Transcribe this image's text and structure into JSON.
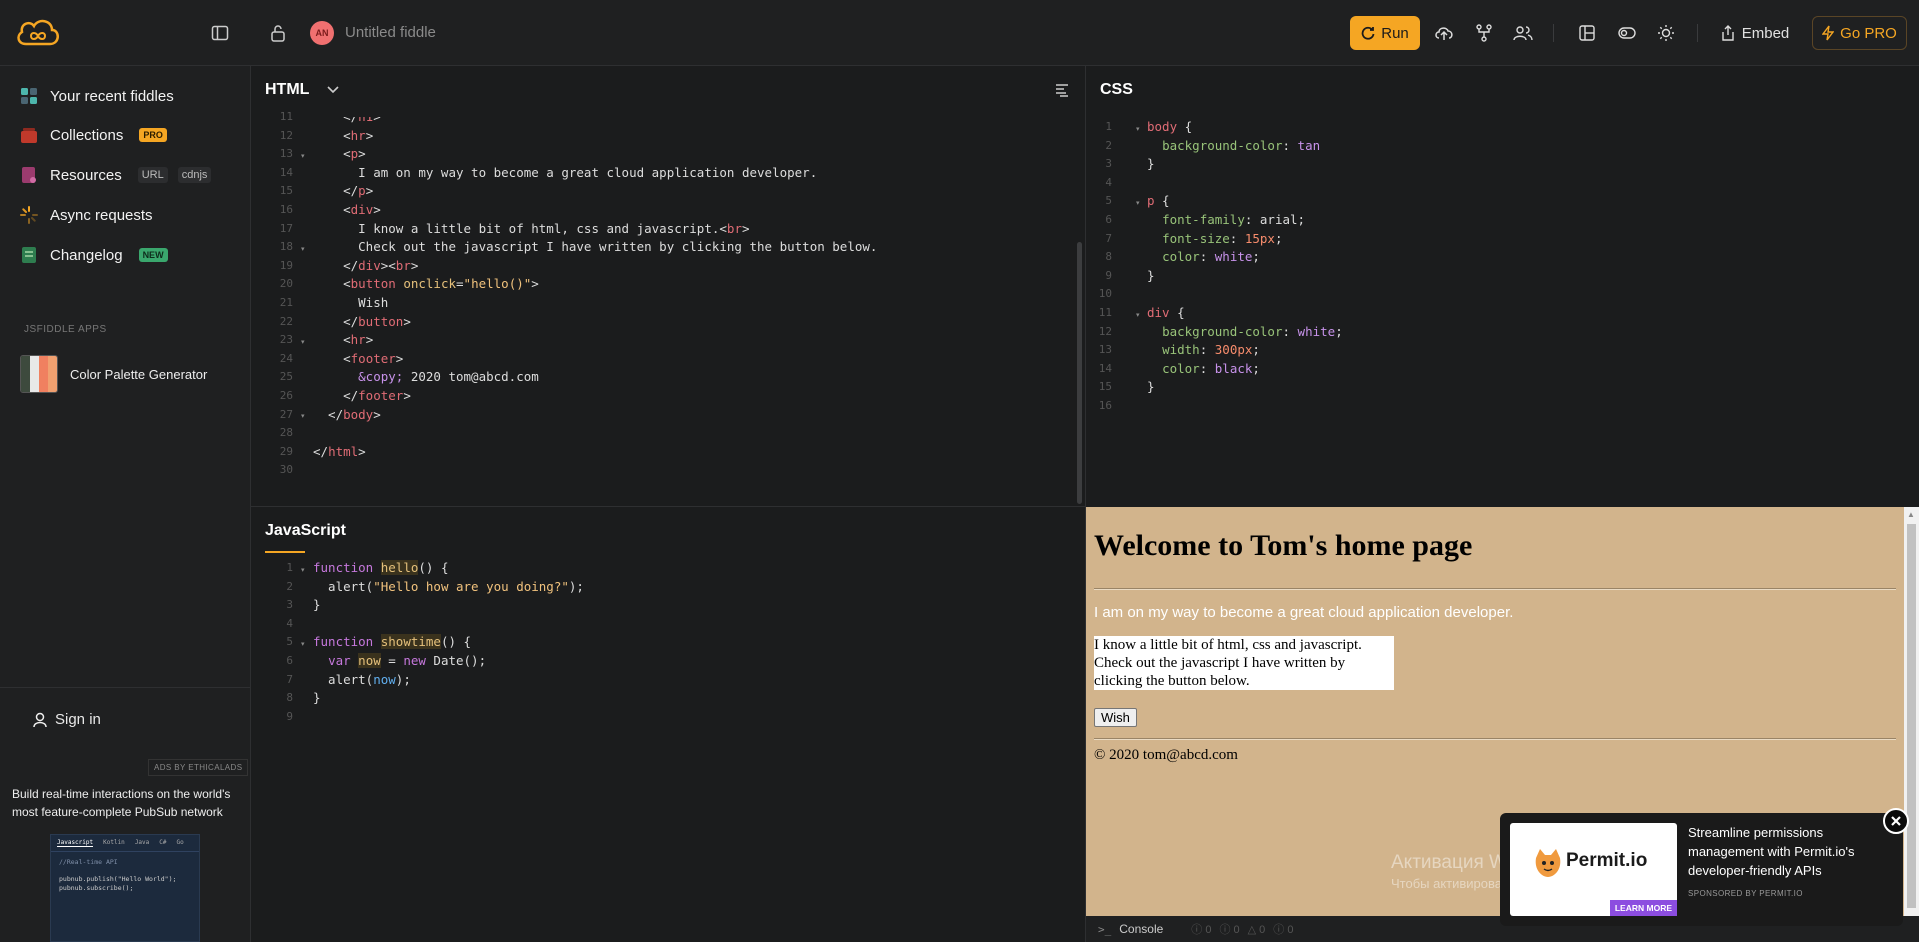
{
  "header": {
    "title": "Untitled fiddle",
    "avatar": "AN",
    "run": "Run",
    "embed": "Embed",
    "gopro": "Go PRO"
  },
  "sidebar": {
    "items": [
      {
        "label": "Your recent fiddles"
      },
      {
        "label": "Collections",
        "badge": "PRO"
      },
      {
        "label": "Resources",
        "chip1": "URL",
        "chip2": "cdnjs"
      },
      {
        "label": "Async requests"
      },
      {
        "label": "Changelog",
        "badge": "NEW"
      }
    ],
    "apps_heading": "JSFIDDLE APPS",
    "app": "Color Palette Generator",
    "signin": "Sign in",
    "ads_by": "ADS BY ETHICALADS",
    "ad_text": "Build real-time interactions on the world's most feature-complete PubSub network",
    "ad_tabs": [
      "Javascript",
      "Kotlin",
      "Java",
      "C#",
      "Go"
    ],
    "ad_code": [
      "//Real-time API",
      "",
      "pubnub.publish(\"Hello World\");",
      "pubnub.subscribe();"
    ]
  },
  "panes": {
    "html": "HTML",
    "css": "CSS",
    "js": "JavaScript"
  },
  "preview": {
    "h1": "Welcome to Tom's home page",
    "p": "I am on my way to become a great cloud application developer.",
    "div": "I know a little bit of html, css and javascript.\nCheck out the javascript I have written by clicking the button below.",
    "button": "Wish",
    "footer": "© 2020 tom@abcd.com"
  },
  "console": {
    "label": "Console",
    "counts": [
      "0",
      "0",
      "0",
      "0"
    ]
  },
  "permit": {
    "brand": "Permit.io",
    "cta": "LEARN MORE",
    "text": "Streamline permissions management with Permit.io's developer-friendly APIs",
    "sponsor": "SPONSORED BY PERMIT.IO"
  },
  "watermark": {
    "line1": "Активация Windows",
    "line2": "Чтобы активировать Windows, перейдите в раздел \"Параметры\"."
  }
}
